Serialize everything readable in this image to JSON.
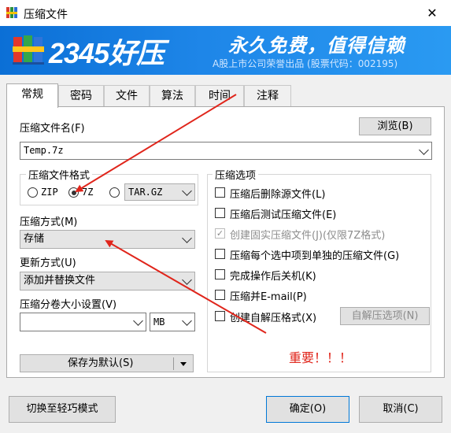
{
  "window": {
    "title": "压缩文件",
    "close_glyph": "✕"
  },
  "banner": {
    "logo_text": "2345好压",
    "slogan": "永久免费，值得信赖",
    "sub_slogan": "A股上市公司荣誉出品 (股票代码：002195)"
  },
  "tabs": [
    {
      "label": "常规",
      "active": true
    },
    {
      "label": "密码"
    },
    {
      "label": "文件"
    },
    {
      "label": "算法"
    },
    {
      "label": "时间"
    },
    {
      "label": "注释"
    }
  ],
  "general": {
    "filename_label": "压缩文件名(F)",
    "browse_label": "浏览(B)",
    "filename_value": "Temp.7z",
    "format_group_title": "压缩文件格式",
    "format_options": [
      {
        "label": "ZIP",
        "selected": false
      },
      {
        "label": "7Z",
        "selected": true
      },
      {
        "label": "",
        "selected": false
      }
    ],
    "format_combo_value": "TAR.GZ",
    "method_label": "压缩方式(M)",
    "method_value": "存储",
    "update_label": "更新方式(U)",
    "update_value": "添加并替换文件",
    "split_label": "压缩分卷大小设置(V)",
    "split_value": "",
    "split_unit": "MB",
    "save_default_label": "保存为默认(S)",
    "options_group_title": "压缩选项",
    "options": [
      {
        "label": "压缩后删除源文件(L)",
        "checked": false,
        "disabled": false
      },
      {
        "label": "压缩后测试压缩文件(E)",
        "checked": false,
        "disabled": false
      },
      {
        "label": "创建固实压缩文件(J)(仅限7Z格式)",
        "checked": true,
        "disabled": true
      },
      {
        "label": "压缩每个选中项到单独的压缩文件(G)",
        "checked": false,
        "disabled": false
      },
      {
        "label": "完成操作后关机(K)",
        "checked": false,
        "disabled": false
      },
      {
        "label": "压缩并E-mail(P)",
        "checked": false,
        "disabled": false
      },
      {
        "label": "创建自解压格式(X)",
        "checked": false,
        "disabled": false
      }
    ],
    "sfx_options_label": "自解压选项(N)",
    "important_note": "重要！！！"
  },
  "footer": {
    "simple_mode_label": "切换至轻巧模式",
    "ok_label": "确定(O)",
    "cancel_label": "取消(C)"
  },
  "colors": {
    "annotation_red": "#e0251b",
    "banner_blue": "#1e86e8"
  }
}
